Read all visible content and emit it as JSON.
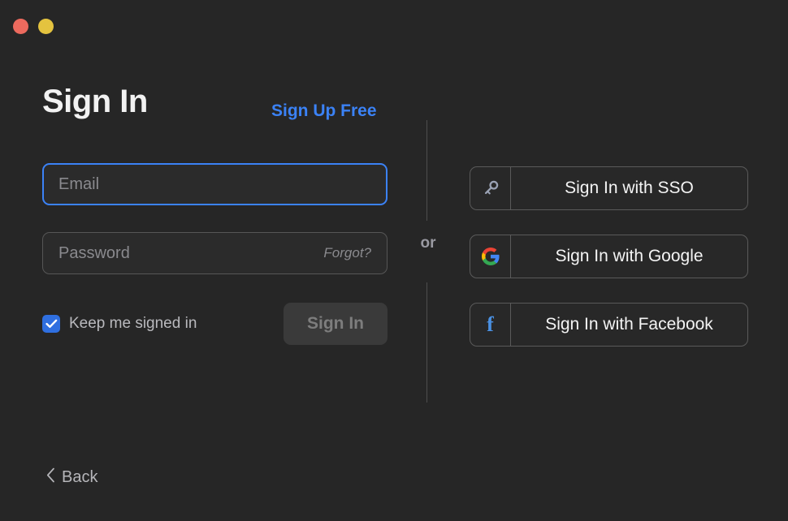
{
  "window": {
    "controls": [
      {
        "name": "close",
        "color": "#ec6a5e"
      },
      {
        "name": "minimize",
        "color": "#e4c33f"
      }
    ]
  },
  "header": {
    "title": "Sign In",
    "signup_link": "Sign Up Free"
  },
  "form": {
    "email": {
      "placeholder": "Email",
      "value": "",
      "focused": true
    },
    "password": {
      "placeholder": "Password",
      "value": "",
      "forgot_label": "Forgot?"
    },
    "keep_signed_in": {
      "label": "Keep me signed in",
      "checked": true
    },
    "submit_label": "Sign In"
  },
  "divider": {
    "label": "or"
  },
  "sso": {
    "buttons": [
      {
        "icon": "key-icon",
        "label": "Sign In with SSO"
      },
      {
        "icon": "google-icon",
        "label": "Sign In with Google"
      },
      {
        "icon": "facebook-icon",
        "label": "Sign In with Facebook",
        "glyph": "f"
      }
    ]
  },
  "footer": {
    "back_label": "Back"
  },
  "colors": {
    "background": "#262626",
    "accent_blue": "#3b82f6",
    "checkbox_blue": "#2f6fe0",
    "facebook_blue": "#4a90e2",
    "text_primary": "#f2f2f2",
    "text_muted": "#8a8a8e",
    "border": "#5a5a5a"
  }
}
